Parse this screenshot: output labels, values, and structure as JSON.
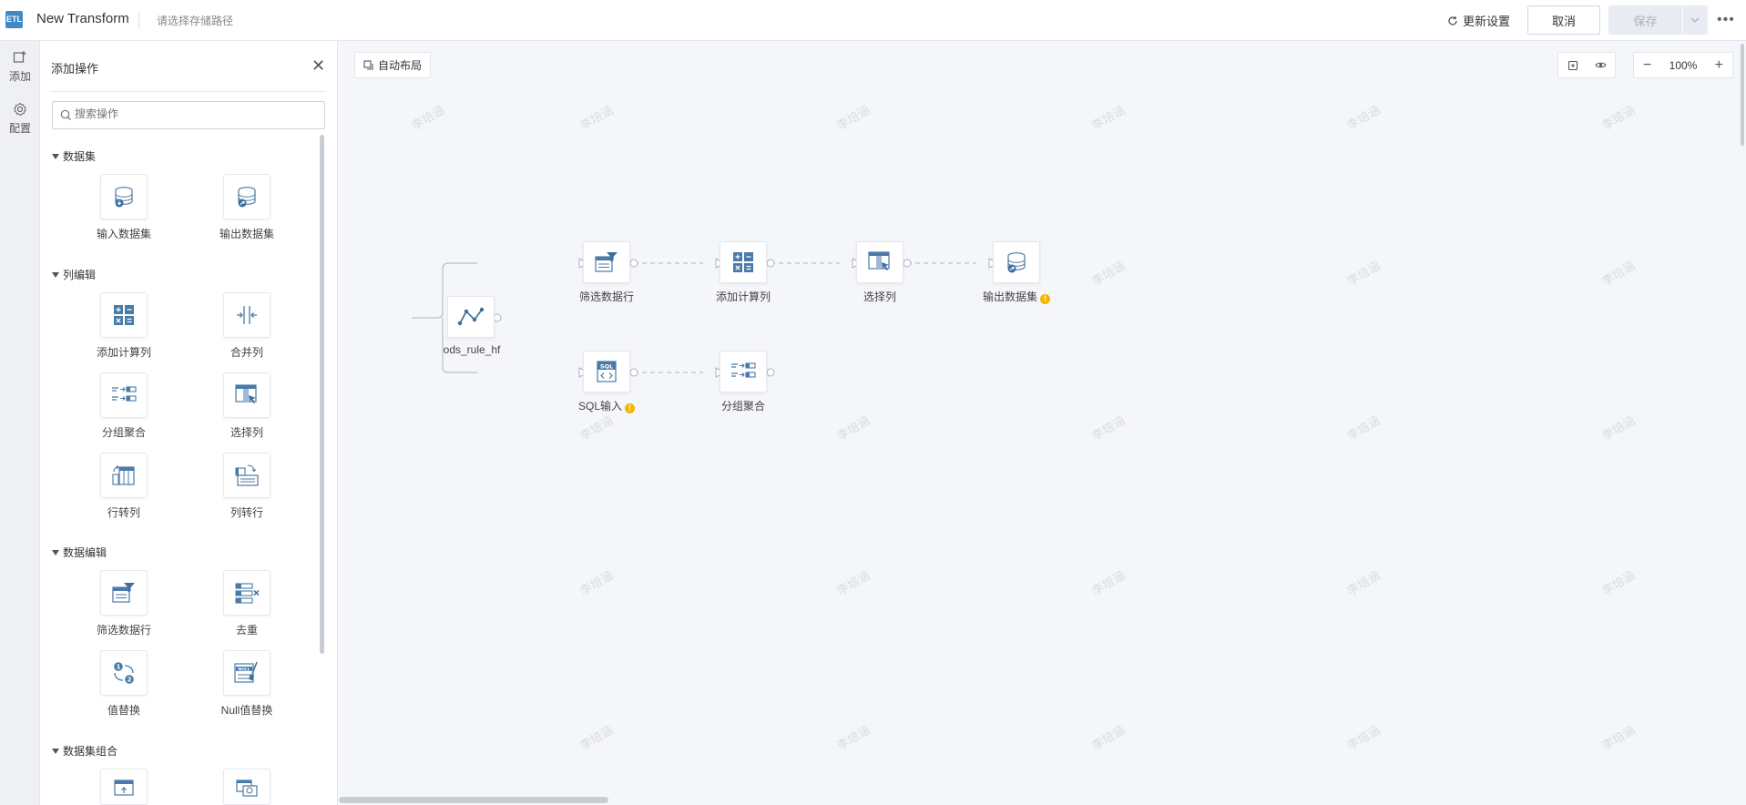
{
  "header": {
    "logo_text": "ETL",
    "title": "New Transform",
    "path_placeholder": "请选择存储路径",
    "refresh_label": "更新设置",
    "cancel_label": "取消",
    "save_label": "保存",
    "more_label": "•••"
  },
  "rail": {
    "add_label": "添加",
    "config_label": "配置"
  },
  "panel": {
    "title": "添加操作",
    "search_placeholder": "搜索操作",
    "sections": [
      {
        "label": "数据集",
        "ops": [
          "输入数据集",
          "输出数据集"
        ]
      },
      {
        "label": "列编辑",
        "ops": [
          "添加计算列",
          "合并列",
          "分组聚合",
          "选择列",
          "行转列",
          "列转行"
        ]
      },
      {
        "label": "数据编辑",
        "ops": [
          "筛选数据行",
          "去重",
          "值替换",
          "Null值替换"
        ]
      },
      {
        "label": "数据集组合",
        "ops": []
      }
    ]
  },
  "canvas": {
    "auto_layout_label": "自动布局",
    "zoom_level": "100%",
    "watermark_text": "李培涵",
    "nodes": {
      "source": "ods_rule_hf",
      "filter": "筛选数据行",
      "calc": "添加计算列",
      "select": "选择列",
      "output": "输出数据集",
      "sql": "SQL输入",
      "group": "分组聚合"
    }
  },
  "colors": {
    "accent": "#3f8ac6",
    "warning": "#f4b400"
  }
}
